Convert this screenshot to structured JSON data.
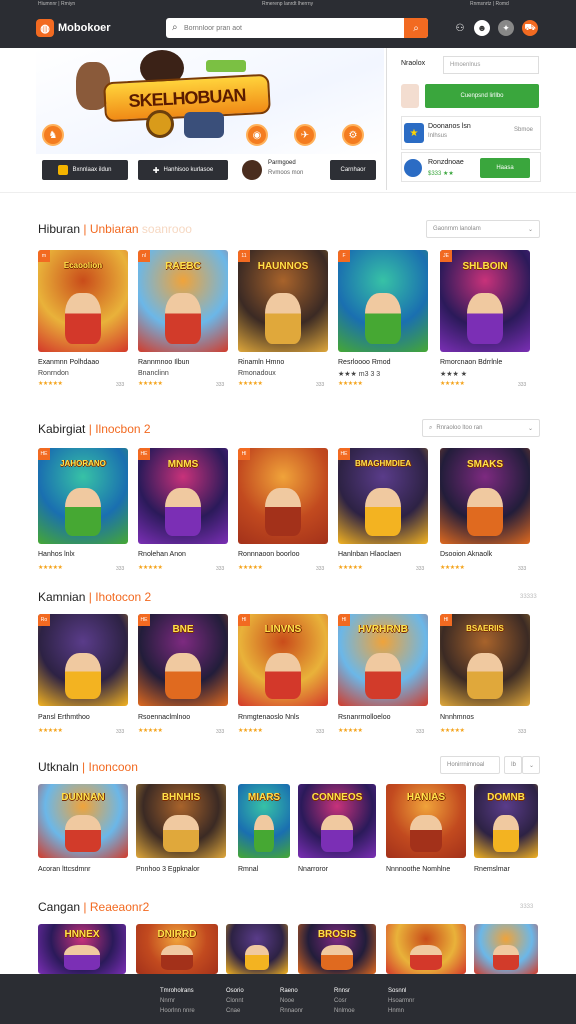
{
  "topstrip": {
    "left": "Hiumnnr | Rmiyn",
    "mid": "Rmerenp lanrdt lherrny",
    "right": "Rnmsnrtz  |  Romd"
  },
  "header": {
    "logo_text": "Mobokoer",
    "search_placeholder": "Bornnloor pran aot",
    "icons": [
      "user-icon",
      "avatar-icon",
      "gift-icon",
      "cart-icon"
    ],
    "accent": "#f26a21",
    "bg": "#2b2d33"
  },
  "hero": {
    "banner_title": "SKELHOBUAN",
    "buttons": [
      "Bxnnlaax ildun",
      "Hanhisoo kurlasoe"
    ],
    "feature_title": "Parmgoed",
    "feature_sub": "Rvmoos mon",
    "right_button": "Carnhaor"
  },
  "sidepanel": {
    "label": "Nraolox",
    "input_value": "Hmoenlnus",
    "primary_button": "Cuenpsnd lirllbo",
    "app1_title": "Doonanos lsn",
    "app1_meta": "Inlhsus",
    "app1_value": "Sbmoe",
    "app2_title": "Ronzdnoae",
    "app2_rating": "$333 ★★",
    "app2_button": "Haasa"
  },
  "sections": [
    {
      "title": "Hiburan",
      "sub": "Unbiaran",
      "ghost": "soanrooo",
      "control": "Gaonrnm lanolam",
      "games": [
        {
          "name": "Exanmnn Polhdaao",
          "sub": "Ronrndon",
          "badge": "m",
          "art": "Ecaoolion",
          "meta": "333"
        },
        {
          "name": "Rannmnoo Ilbun",
          "sub": "Bnanclinn",
          "badge": "nl",
          "art": "RAEBC",
          "meta": "333"
        },
        {
          "name": "Rinamln Hmno",
          "sub": "Rmonadoux",
          "badge": "11",
          "art": "HAUNNOS",
          "meta": "333"
        },
        {
          "name": "Resrloooo Rmod",
          "sub": "★★★ m3 3 3",
          "badge": "F",
          "art": "",
          "meta": ""
        },
        {
          "name": "Rmorcnaon Bdrrlnle",
          "sub": "★★★ ★",
          "badge": "JE",
          "art": "SHLBOIN",
          "meta": "333"
        }
      ]
    },
    {
      "title": "Kabirgiat",
      "sub": "Ilnocbon 2",
      "ghost": "",
      "control": "Rnraoloo ltoo ran",
      "games": [
        {
          "name": "Hanhos lnlx",
          "sub": "",
          "badge": "HE",
          "art": "JAHORANO",
          "meta": "333"
        },
        {
          "name": "Rnolehan Anon",
          "sub": "",
          "badge": "HE",
          "art": "MNMS",
          "meta": "333"
        },
        {
          "name": "Ronnnaoon boorloo",
          "sub": "",
          "badge": "Hl",
          "art": "",
          "meta": "333"
        },
        {
          "name": "Hanlnban Hlaoclaen",
          "sub": "",
          "badge": "HE",
          "art": "BMAGHMDIEA",
          "meta": "333"
        },
        {
          "name": "Dsooion Aknaolk",
          "sub": "",
          "badge": "",
          "art": "SMAKS",
          "meta": "333"
        }
      ]
    },
    {
      "title": "Kamnian",
      "sub": "Ihotocon 2",
      "ghost": "",
      "control": "",
      "extra": "33333",
      "games": [
        {
          "name": "Pansl Erthmthoo",
          "sub": "",
          "badge": "Ro",
          "art": "",
          "meta": "333"
        },
        {
          "name": "Rsoennaclmlnoo",
          "sub": "",
          "badge": "HE",
          "art": "BNE",
          "meta": "333"
        },
        {
          "name": "Rnmgtenaoslo Nnls",
          "sub": "",
          "badge": "Hl",
          "art": "LINVNS",
          "meta": "333"
        },
        {
          "name": "Rsnanrmolloeloo",
          "sub": "",
          "badge": "Hl",
          "art": "HVRHRNB",
          "meta": "333"
        },
        {
          "name": "Nnnhmnos",
          "sub": "",
          "badge": "Hl",
          "art": "BSAERIIS",
          "meta": "333"
        }
      ]
    },
    {
      "title": "Utknaln",
      "sub": "Inoncoon",
      "ghost": "",
      "control": "Honirrnimnoal",
      "control2": "Ib",
      "games": [
        {
          "name": "Acoran lttcsdmnr",
          "sub": "",
          "badge": "",
          "art": "DUNNAN",
          "meta": ""
        },
        {
          "name": "Pnnhoo 3 Egpknalor",
          "sub": "",
          "badge": "",
          "art": "BHNHIS",
          "meta": ""
        },
        {
          "name": "Rmnal",
          "sub": "",
          "badge": "",
          "art": "MIARS",
          "meta": ""
        },
        {
          "name": "Nnarroror",
          "sub": "",
          "badge": "",
          "art": "CONNEOS",
          "meta": ""
        },
        {
          "name": "Nnnnoothe Nomhlne",
          "sub": "",
          "badge": "",
          "art": "HANIAS",
          "meta": ""
        },
        {
          "name": "Rnemslmar",
          "sub": "",
          "badge": "",
          "art": "DOMNB",
          "meta": ""
        }
      ]
    },
    {
      "title": "Cangan",
      "sub": "Reaeaonr2",
      "ghost": "",
      "control": "",
      "extra": "3333",
      "games": [
        {
          "name": "",
          "sub": "",
          "badge": "",
          "art": "HNNEX",
          "meta": ""
        },
        {
          "name": "",
          "sub": "",
          "badge": "",
          "art": "DNIRRD",
          "meta": ""
        },
        {
          "name": "",
          "sub": "",
          "badge": "",
          "art": "",
          "meta": ""
        },
        {
          "name": "",
          "sub": "",
          "badge": "",
          "art": "BROSIS",
          "meta": ""
        },
        {
          "name": "",
          "sub": "",
          "badge": "",
          "art": "",
          "meta": ""
        },
        {
          "name": "",
          "sub": "",
          "badge": "",
          "art": "",
          "meta": ""
        }
      ]
    }
  ],
  "footer": {
    "cols": [
      {
        "head": "Tmroholrans",
        "items": [
          "Nnrnr",
          "Hoorlnn nnre"
        ]
      },
      {
        "head": "Osorio",
        "items": [
          "Clonnt",
          "Cnae"
        ]
      },
      {
        "head": "Raeno",
        "items": [
          "Nooe",
          "Rnnaonr"
        ]
      },
      {
        "head": "Rnnsr",
        "items": [
          "Cosr",
          "Nnlmoe"
        ]
      },
      {
        "head": "Sosnnl",
        "items": [
          "Hsoarmnr",
          "Hnmn"
        ]
      }
    ]
  }
}
